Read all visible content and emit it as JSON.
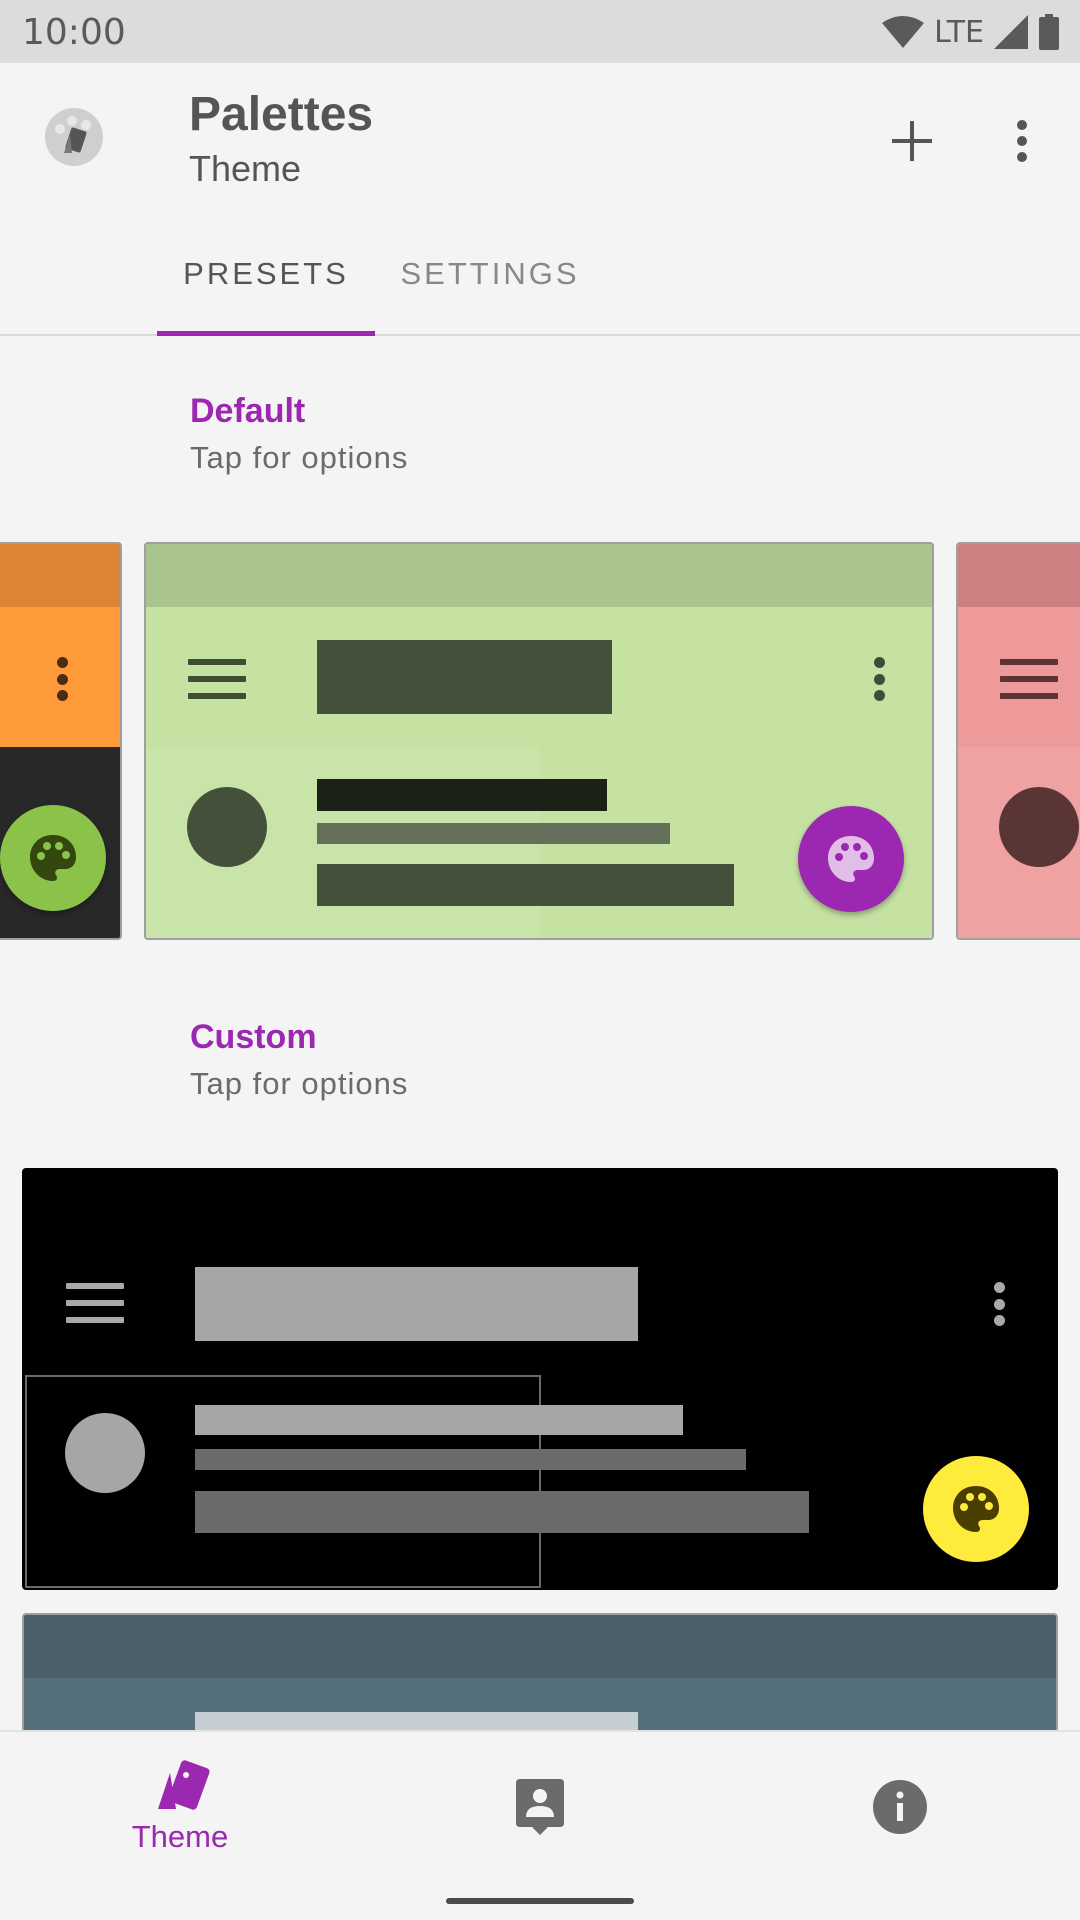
{
  "status_bar": {
    "time": "10:00",
    "network": "LTE"
  },
  "app_bar": {
    "title": "Palettes",
    "subtitle": "Theme"
  },
  "tabs": [
    {
      "label": "PRESETS",
      "active": true
    },
    {
      "label": "SETTINGS",
      "active": false
    }
  ],
  "sections": {
    "default": {
      "title": "Default",
      "hint": "Tap for options"
    },
    "custom": {
      "title": "Custom",
      "hint": "Tap for options"
    }
  },
  "presets": {
    "default_left": {
      "primary_dark": "#dd8433",
      "primary": "#ff9a3b",
      "background": "#282828",
      "accent": "#8bc34a"
    },
    "default_center": {
      "primary_dark": "#a9c48d",
      "primary": "#c5e2a3",
      "background": "#c5e2a3",
      "accent": "#9c27b0"
    },
    "default_right": {
      "primary_dark": "#cd7f82",
      "primary": "#ef9a9a",
      "background": "#ef9a9a"
    },
    "custom_black": {
      "primary_dark": "#000000",
      "primary": "#000000",
      "background": "#000000",
      "accent": "#ffeb3b"
    },
    "custom_bluegrey": {
      "primary_dark": "#4a5f6a",
      "primary": "#546e7a"
    }
  },
  "bottom_nav": [
    {
      "label": "Theme",
      "icon": "theme-cards-icon",
      "active": true
    },
    {
      "label": "",
      "icon": "contact-icon",
      "active": false
    },
    {
      "label": "",
      "icon": "info-icon",
      "active": false
    }
  ],
  "colors": {
    "accent": "#9c27b0",
    "background": "#f4f4f4"
  }
}
